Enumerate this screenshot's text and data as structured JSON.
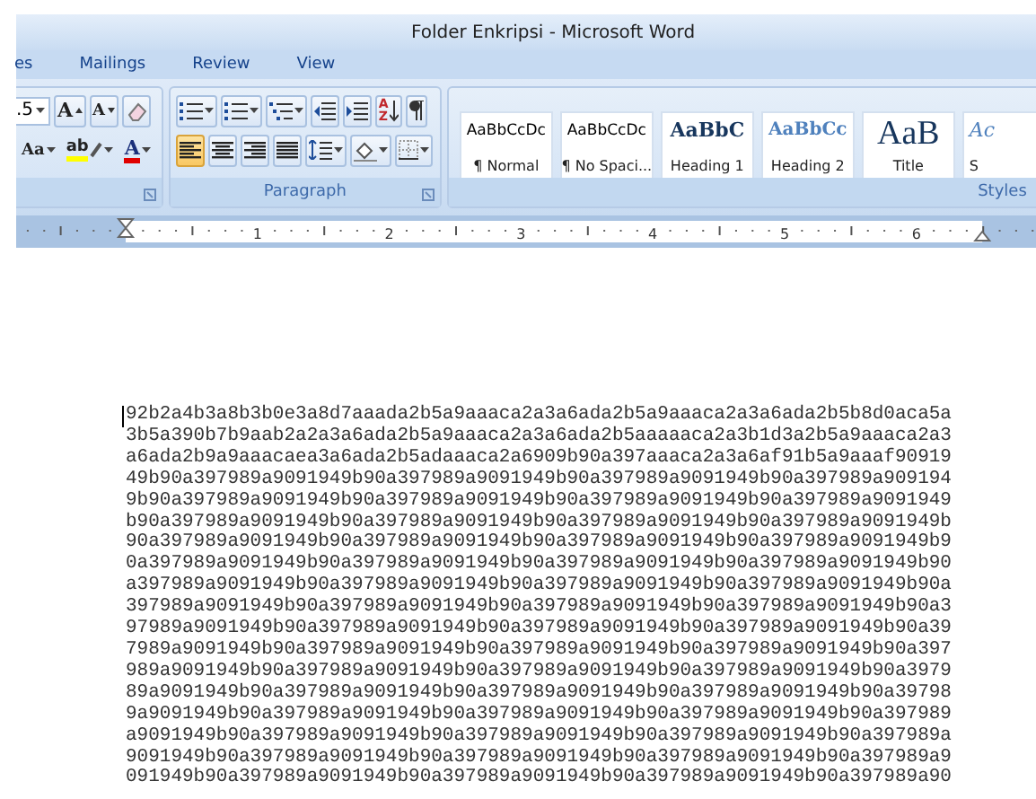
{
  "window": {
    "title": "Folder Enkripsi - Microsoft Word"
  },
  "tabs": [
    {
      "label": "es",
      "selected": false
    },
    {
      "label": "Mailings",
      "selected": false
    },
    {
      "label": "Review",
      "selected": false
    },
    {
      "label": "View",
      "selected": false
    }
  ],
  "font_group": {
    "size": ".5",
    "grow": "A",
    "shrink": "A",
    "change_case": "Aa",
    "highlight": "ab",
    "font_color": "A"
  },
  "paragraph_group": {
    "label": "Paragraph",
    "sort": [
      "A",
      "Z"
    ],
    "alignment": [
      {
        "kind": "left",
        "selected": true
      },
      {
        "kind": "center",
        "selected": false
      },
      {
        "kind": "right",
        "selected": false
      },
      {
        "kind": "justify",
        "selected": false
      }
    ]
  },
  "styles_group": {
    "label": "Styles",
    "items": [
      {
        "kind": "normal",
        "preview": "AaBbCcDc",
        "name": "¶ Normal"
      },
      {
        "kind": "normal",
        "preview": "AaBbCcDc",
        "name": "¶ No Spaci..."
      },
      {
        "kind": "heading1",
        "preview": "AaBbC",
        "name": "Heading 1"
      },
      {
        "kind": "heading2",
        "preview": "AaBbCc",
        "name": "Heading 2"
      },
      {
        "kind": "title",
        "preview": "AaB",
        "name": "Title"
      },
      {
        "kind": "partial",
        "preview": "Ac",
        "name": "S"
      }
    ]
  },
  "ruler": {
    "numbers": [
      "1",
      "2",
      "3",
      "4",
      "5",
      "6"
    ]
  },
  "document": {
    "lines": [
      "92b2a4b3a8b3b0e3a8d7aaada2b5a9aaaca2a3a6ada2b5a9aaaca2a3a6ada2b5b8d0aca5a",
      "3b5a390b7b9aab2a2a3a6ada2b5a9aaaca2a3a6ada2b5aaaaaca2a3b1d3a2b5a9aaaca2a3",
      "a6ada2b9a9aaacaea3a6ada2b5adaaaca2a6909b90a397aaaca2a3a6af91b5a9aaaf90919",
      "49b90a397989a9091949b90a397989a9091949b90a397989a9091949b90a397989a909194",
      "9b90a397989a9091949b90a397989a9091949b90a397989a9091949b90a397989a9091949",
      "b90a397989a9091949b90a397989a9091949b90a397989a9091949b90a397989a9091949b",
      "90a397989a9091949b90a397989a9091949b90a397989a9091949b90a397989a9091949b9",
      "0a397989a9091949b90a397989a9091949b90a397989a9091949b90a397989a9091949b90",
      "a397989a9091949b90a397989a9091949b90a397989a9091949b90a397989a9091949b90a",
      "397989a9091949b90a397989a9091949b90a397989a9091949b90a397989a9091949b90a3",
      "97989a9091949b90a397989a9091949b90a397989a9091949b90a397989a9091949b90a39",
      "7989a9091949b90a397989a9091949b90a397989a9091949b90a397989a9091949b90a397",
      "989a9091949b90a397989a9091949b90a397989a9091949b90a397989a9091949b90a3979",
      "89a9091949b90a397989a9091949b90a397989a9091949b90a397989a9091949b90a39798",
      "9a9091949b90a397989a9091949b90a397989a9091949b90a397989a9091949b90a397989",
      "a9091949b90a397989a9091949b90a397989a9091949b90a397989a9091949b90a397989a",
      "9091949b90a397989a9091949b90a397989a9091949b90a397989a9091949b90a397989a9",
      "091949b90a397989a9091949b90a397989a9091949b90a397989a9091949b90a397989a90"
    ]
  }
}
